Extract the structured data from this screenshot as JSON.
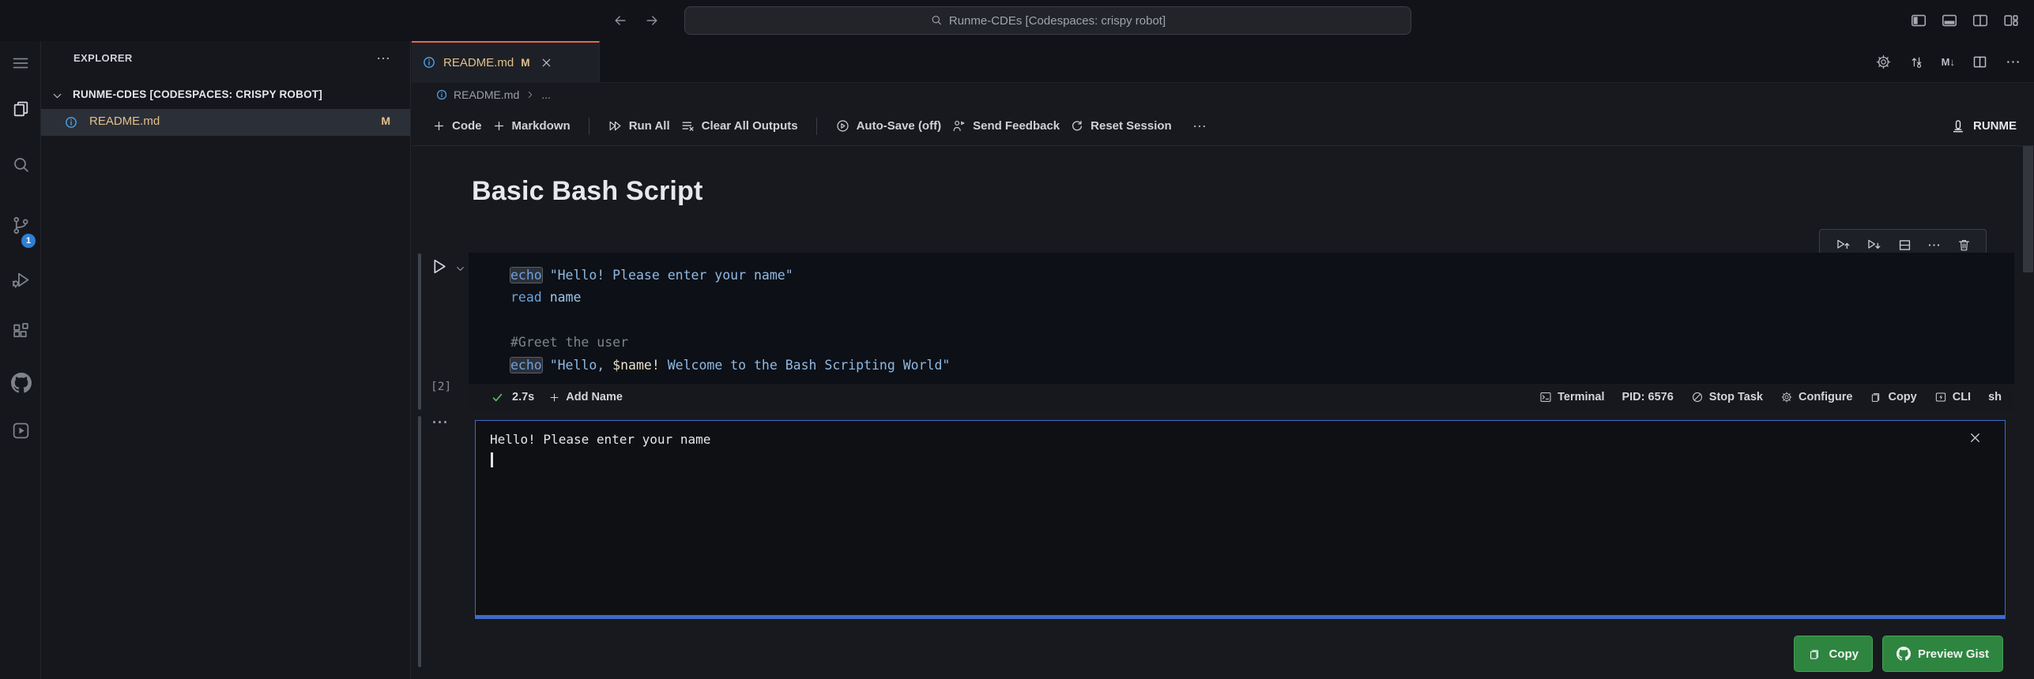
{
  "titlebar": {
    "search": {
      "value": "Runme-CDEs [Codespaces: crispy robot]"
    }
  },
  "activity_bar": {
    "scm_badge": "1"
  },
  "sidebar": {
    "title": "EXPLORER",
    "section": "RUNME-CDES [CODESPACES: CRISPY ROBOT]",
    "file": {
      "name": "README.md",
      "badge": "M"
    }
  },
  "editor": {
    "tab": {
      "label": "README.md",
      "badge": "M"
    },
    "actions": {
      "md_preview": "M↓"
    },
    "breadcrumb": {
      "file": "README.md",
      "ellipsis": "..."
    },
    "toolbar": {
      "code": "Code",
      "markdown": "Markdown",
      "run_all": "Run All",
      "clear_outputs": "Clear All Outputs",
      "auto_save": "Auto-Save (off)",
      "send_feedback": "Send Feedback",
      "reset_session": "Reset Session",
      "kernel": "RUNME"
    }
  },
  "notebook": {
    "heading": "Basic Bash Script",
    "cell": {
      "execution_count": "[2]",
      "language": "sh",
      "code_lines": [
        {
          "tokens": [
            {
              "text": "echo",
              "type": "keyword",
              "highlight": true
            },
            {
              "text": " ",
              "type": "plain"
            },
            {
              "text": "\"Hello! Please enter your name\"",
              "type": "string"
            }
          ]
        },
        {
          "tokens": [
            {
              "text": "read",
              "type": "keyword"
            },
            {
              "text": " ",
              "type": "plain"
            },
            {
              "text": "name",
              "type": "parameter"
            }
          ]
        },
        {
          "tokens": []
        },
        {
          "tokens": [
            {
              "text": "#Greet the user",
              "type": "comment"
            }
          ]
        },
        {
          "tokens": [
            {
              "text": "echo",
              "type": "keyword",
              "highlight": true
            },
            {
              "text": " ",
              "type": "plain"
            },
            {
              "text": "\"Hello, ",
              "type": "string"
            },
            {
              "text": "$name!",
              "type": "variable"
            },
            {
              "text": " Welcome to the Bash Scripting World\"",
              "type": "string"
            }
          ]
        }
      ],
      "status": {
        "duration": "2.7s",
        "add_name": "Add Name",
        "terminal": "Terminal",
        "pid": "PID: 6576",
        "stop_task": "Stop Task",
        "configure": "Configure",
        "copy": "Copy",
        "cli": "CLI"
      }
    },
    "output": {
      "text": "Hello! Please enter your name"
    },
    "gist_actions": {
      "copy": "Copy",
      "preview_gist": "Preview Gist"
    }
  },
  "colors": {
    "tab_accent": "#e0694f",
    "modified_yellow": "#e2c08d",
    "info_blue": "#4ba0e8",
    "focus_border_blue": "#3d6ac9",
    "button_green": "#2e8540",
    "scm_badge_blue": "#2f7fd6",
    "success_green": "#5fb562"
  }
}
